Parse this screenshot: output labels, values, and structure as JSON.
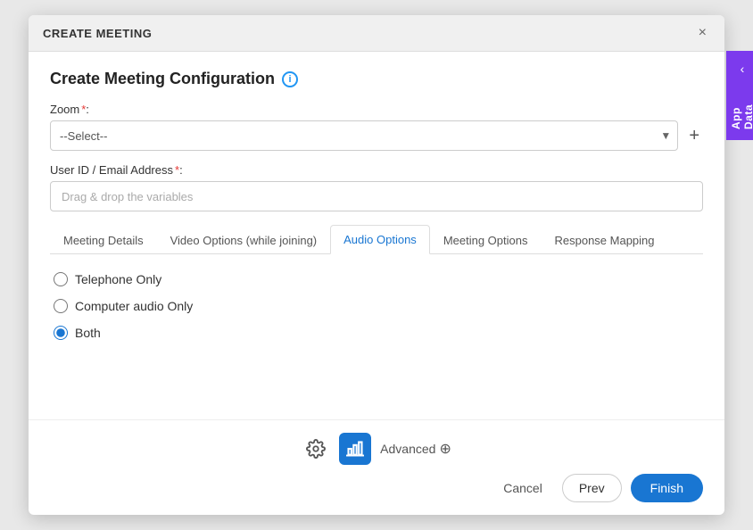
{
  "modal": {
    "title": "CREATE MEETING",
    "config_title": "Create Meeting Configuration",
    "close_icon": "×"
  },
  "app_data_panel": {
    "label": "App Data",
    "chevron": "‹"
  },
  "fields": {
    "zoom_label": "Zoom",
    "zoom_placeholder": "--Select--",
    "zoom_required": "*",
    "user_id_label": "User ID / Email Address",
    "user_id_required": "*",
    "user_id_placeholder": "Drag & drop the variables"
  },
  "tabs": [
    {
      "id": "meeting-details",
      "label": "Meeting Details",
      "active": false
    },
    {
      "id": "video-options",
      "label": "Video Options (while joining)",
      "active": false
    },
    {
      "id": "audio-options",
      "label": "Audio Options",
      "active": true
    },
    {
      "id": "meeting-options",
      "label": "Meeting Options",
      "active": false
    },
    {
      "id": "response-mapping",
      "label": "Response Mapping",
      "active": false
    }
  ],
  "audio_options": {
    "options": [
      {
        "id": "telephone",
        "label": "Telephone Only",
        "checked": false
      },
      {
        "id": "computer",
        "label": "Computer audio Only",
        "checked": false
      },
      {
        "id": "both",
        "label": "Both",
        "checked": true
      }
    ]
  },
  "footer": {
    "advanced_label": "Advanced",
    "cancel_label": "Cancel",
    "prev_label": "Prev",
    "finish_label": "Finish"
  }
}
